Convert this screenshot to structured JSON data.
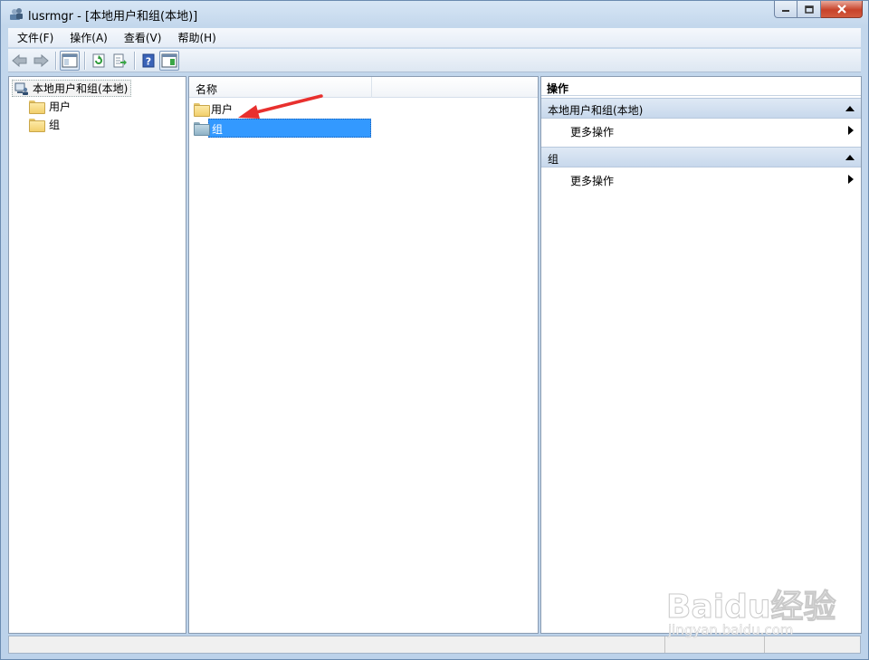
{
  "window": {
    "title": "lusrmgr - [本地用户和组(本地)]"
  },
  "menu": {
    "items": [
      {
        "label": "文件(F)"
      },
      {
        "label": "操作(A)"
      },
      {
        "label": "查看(V)"
      },
      {
        "label": "帮助(H)"
      }
    ]
  },
  "toolbar": {
    "buttons": [
      {
        "icon": "back-arrow-icon"
      },
      {
        "icon": "forward-arrow-icon"
      },
      {
        "icon": "show-hide-console-tree-icon"
      },
      {
        "icon": "refresh-icon"
      },
      {
        "icon": "export-list-icon"
      },
      {
        "icon": "help-icon"
      },
      {
        "icon": "show-hide-action-pane-icon"
      }
    ]
  },
  "tree": {
    "root_label": "本地用户和组(本地)",
    "children": [
      {
        "label": "用户"
      },
      {
        "label": "组"
      }
    ]
  },
  "list": {
    "column_name": "名称",
    "items": [
      {
        "label": "用户",
        "selected": false
      },
      {
        "label": "组",
        "selected": true
      }
    ],
    "annotation_color": "#e8302e"
  },
  "actions": {
    "header": "操作",
    "sections": [
      {
        "title": "本地用户和组(本地)",
        "items": [
          {
            "label": "更多操作"
          }
        ]
      },
      {
        "title": "组",
        "items": [
          {
            "label": "更多操作"
          }
        ]
      }
    ]
  },
  "watermark": {
    "brand": "Baidu经验",
    "url": "jingyan.baidu.com"
  },
  "colors": {
    "selection": "#3399ff",
    "section_header": "#c7d8ec",
    "window_frame": "#bcd2ea"
  }
}
